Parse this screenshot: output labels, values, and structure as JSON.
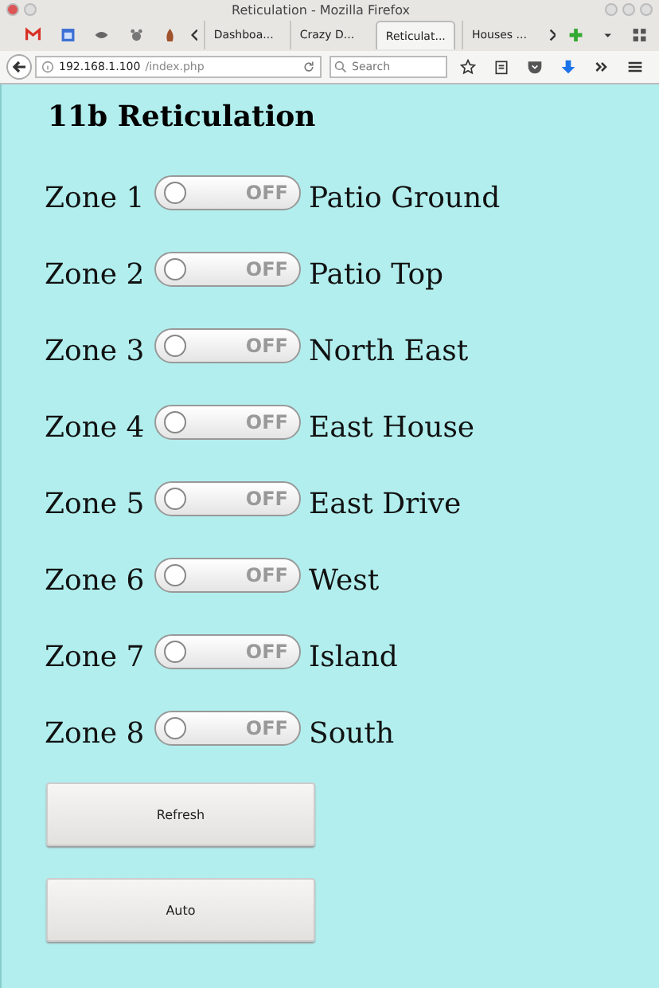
{
  "window": {
    "title": "Reticulation - Mozilla Firefox"
  },
  "tabs": [
    {
      "label": "Dashboa...",
      "selected": false
    },
    {
      "label": "Crazy D...",
      "selected": false
    },
    {
      "label": "Reticulat...",
      "selected": true
    },
    {
      "label": "Houses ...",
      "selected": false
    }
  ],
  "address": {
    "host": "192.168.1.100",
    "path": "/index.php"
  },
  "search": {
    "placeholder": "Search"
  },
  "heading": "11b Reticulation",
  "zones": [
    {
      "label": "Zone 1",
      "on": false,
      "state": "OFF",
      "name": "Patio Ground"
    },
    {
      "label": "Zone 2",
      "on": false,
      "state": "OFF",
      "name": "Patio Top"
    },
    {
      "label": "Zone 3",
      "on": false,
      "state": "OFF",
      "name": "North East"
    },
    {
      "label": "Zone 4",
      "on": false,
      "state": "OFF",
      "name": "East House"
    },
    {
      "label": "Zone 5",
      "on": false,
      "state": "OFF",
      "name": "East Drive"
    },
    {
      "label": "Zone 6",
      "on": false,
      "state": "OFF",
      "name": "West"
    },
    {
      "label": "Zone 7",
      "on": false,
      "state": "OFF",
      "name": "Island"
    },
    {
      "label": "Zone 8",
      "on": false,
      "state": "OFF",
      "name": "South"
    }
  ],
  "buttons": [
    "Refresh",
    "Auto"
  ]
}
